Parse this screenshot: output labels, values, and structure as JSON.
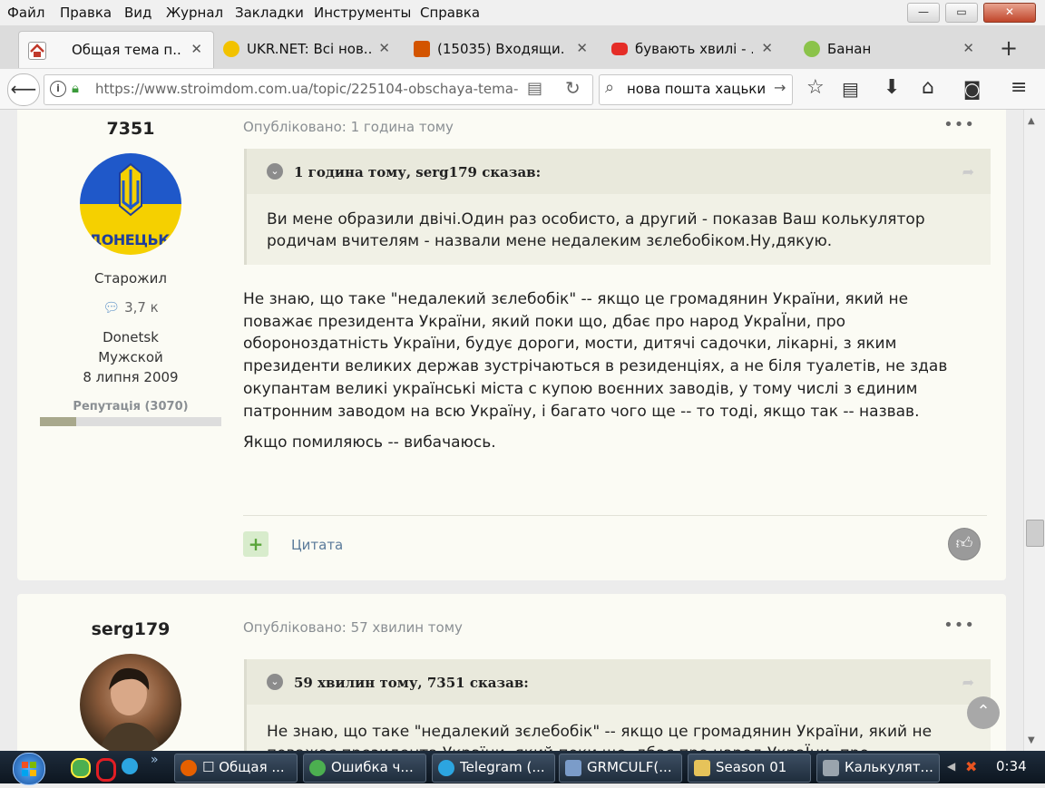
{
  "menu": [
    "Файл",
    "Правка",
    "Вид",
    "Журнал",
    "Закладки",
    "Инструменты",
    "Справка"
  ],
  "window_buttons": {
    "minimize": "—",
    "maximize": "▭",
    "close": "✕"
  },
  "tabs": [
    {
      "label": "Общая тема п...",
      "color": "#c0392b"
    },
    {
      "label": "UKR.NET: Всі нов...",
      "color": "#f2c200"
    },
    {
      "label": "(15035) Входящи...",
      "color": "#d35400"
    },
    {
      "label": "бувають хвилі - ...",
      "color": "#e52d27"
    },
    {
      "label": "Банан",
      "color": "#8bc34a"
    }
  ],
  "new_tab": "+",
  "address": {
    "url": "https://www.stroimdom.com.ua/topic/225104-obschaya-tema-",
    "search": "нова пошта хацьки"
  },
  "posts": [
    {
      "author": "7351",
      "avatar_text": "ДОНЕЦЬК",
      "rank": "Старожил",
      "posts_count": "3,7 к",
      "location": "Donetsk",
      "gender": "Мужской",
      "joined": "8 липня 2009",
      "reputation": "Репутація (3070)",
      "reputation_fraction": 0.2,
      "published": "Опубліковано: 1 година тому",
      "menu": "•••",
      "quote_header": "1 година тому, serg179 сказав:",
      "quote_text": "Ви мене образили двічі.Один раз особисто, а другий - показав Ваш колькулятор родичам вчителям - назвали мене недалеким зєлебобіком.Ну,дякую.",
      "body_lines": [
        "Не знаю, що таке \"недалекий зєлебобік\" -- якщо це громадянин України, який не",
        "поважає президента України, який поки що, дбає про народ УкраЇни, про",
        "обороноздатність України, будує дороги, мости, дитячі садочки, лікарні, з яким",
        "президенти великих держав зустрічаються в резиденціях, а не біля туалетів, не здав",
        "окупантам великі українські міста с купою воєнних заводів, у тому числі з єдиним",
        "патронним заводом на всю Україну,  і багато чого ще -- то тоді, якщо так -- назвав."
      ],
      "body_last": "Якщо помиляюсь -- вибачаюсь.",
      "add_button": "+",
      "quote_action": "Цитата"
    },
    {
      "author": "serg179",
      "published": "Опубліковано: 57 хвилин тому",
      "menu": "•••",
      "quote_header": "59 хвилин тому, 7351 сказав:",
      "quote_line1": "Не знаю, що таке \"недалекий зєлебобік\" -- якщо це громадянин України, який не",
      "quote_line2": "поважає президента України, який поки що, дбає про народ УкраЇни, про"
    }
  ],
  "taskbar": {
    "tasks": [
      {
        "label": "☐ Общая ...",
        "color": "#e66000"
      },
      {
        "label": "Ошибка ч...",
        "color": "#4caf50"
      },
      {
        "label": "Telegram (...",
        "color": "#2ca5e0"
      },
      {
        "label": "GRMCULF(...",
        "color": "#7b9cc9"
      },
      {
        "label": "Season 01",
        "color": "#e6c35a"
      },
      {
        "label": "Калькулят...",
        "color": "#9aa4ad"
      }
    ],
    "more": "»",
    "clock": "0:34"
  },
  "colors": {
    "accent": "#5a8fc7",
    "plus_green": "#5aa53a"
  }
}
